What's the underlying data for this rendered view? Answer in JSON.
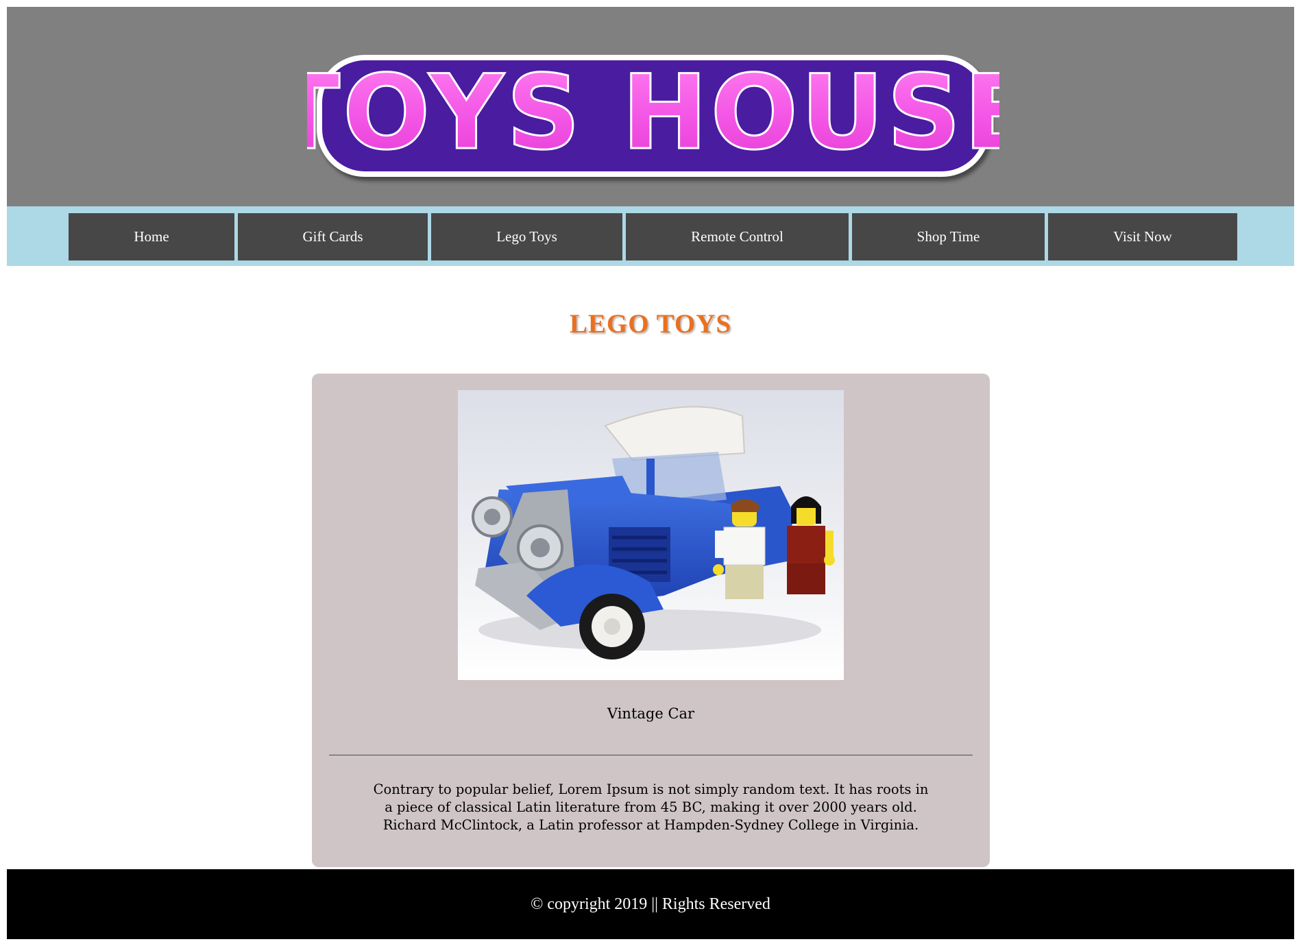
{
  "logo": {
    "text": "TOYS HOUSE"
  },
  "nav": {
    "items": [
      {
        "label": "Home"
      },
      {
        "label": "Gift Cards"
      },
      {
        "label": "Lego Toys"
      },
      {
        "label": "Remote Control"
      },
      {
        "label": "Shop Time"
      },
      {
        "label": "Visit Now"
      }
    ]
  },
  "main": {
    "title": "LEGO TOYS",
    "product": {
      "caption": "Vintage Car",
      "description": "Contrary to popular belief, Lorem Ipsum is not simply random text. It has roots in a piece of classical Latin literature from 45 BC, making it over 2000 years old. Richard McClintock, a Latin professor at Hampden-Sydney College in Virginia."
    }
  },
  "footer": {
    "text": "© copyright 2019 || Rights Reserved"
  },
  "colors": {
    "header_bg": "#808080",
    "nav_bg": "#add8e6",
    "nav_item_bg": "#474747",
    "title": "#ea7020",
    "card_bg": "#cfc5c6",
    "footer_bg": "#000000",
    "logo_fill": "#f55ee8",
    "logo_outline": "#4a1aa0"
  }
}
